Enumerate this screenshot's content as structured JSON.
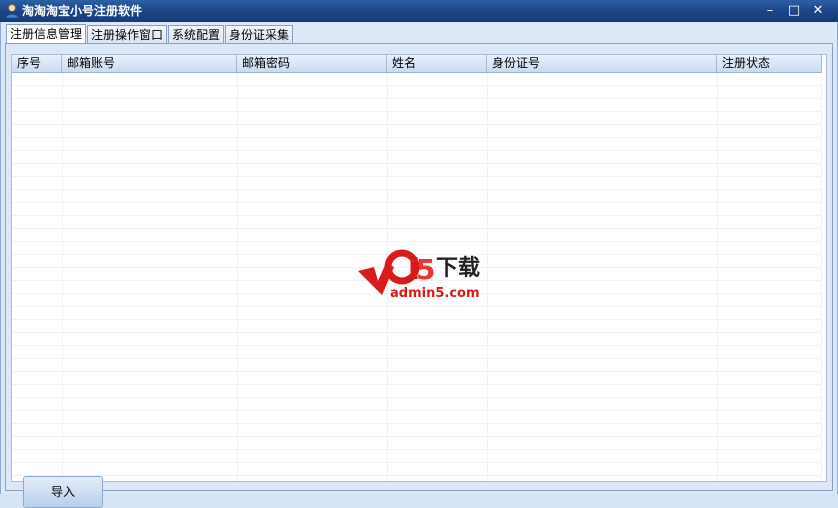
{
  "window": {
    "title": "淘淘淘宝小号注册软件",
    "minimize_glyph": "–",
    "maximize_glyph": "□",
    "close_glyph": "✕"
  },
  "tabs": [
    {
      "label": "注册信息管理",
      "active": true
    },
    {
      "label": "注册操作窗口",
      "active": false
    },
    {
      "label": "系统配置",
      "active": false
    },
    {
      "label": "身份证采集",
      "active": false
    }
  ],
  "table": {
    "columns": [
      "序号",
      "邮箱账号",
      "邮箱密码",
      "姓名",
      "身份证号",
      "注册状态"
    ],
    "rows": []
  },
  "buttons": {
    "import_label": "导入"
  },
  "watermark": {
    "brand": "a5",
    "title": "下载",
    "url": "admin5.com",
    "colors": {
      "red": "#e01b1b",
      "dark": "#222222"
    }
  },
  "colors": {
    "titlebar": "#1c4688",
    "accent": "#c9daf0"
  }
}
